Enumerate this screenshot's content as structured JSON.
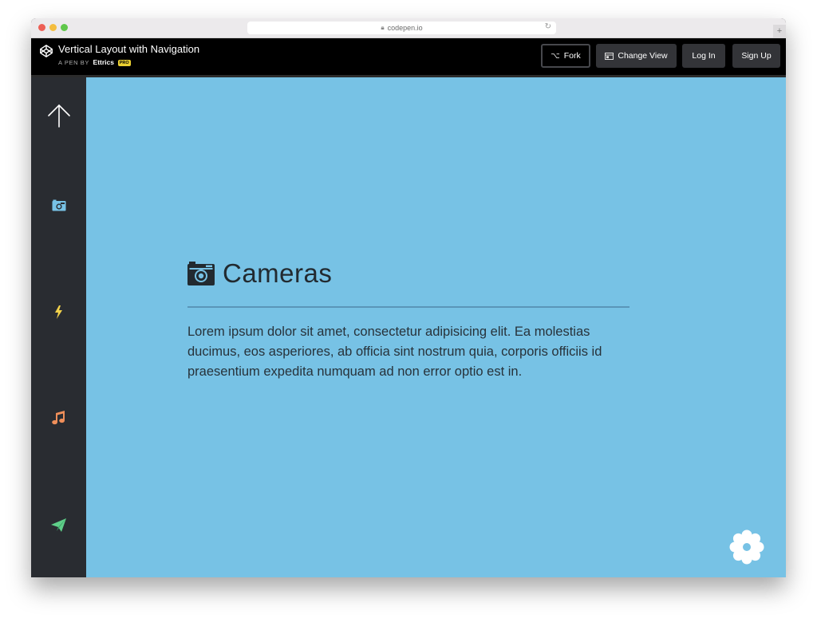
{
  "browser": {
    "url": "codepen.io"
  },
  "header": {
    "title": "Vertical Layout with Navigation",
    "by_prefix": "A PEN BY",
    "author": "Ettrics",
    "badge": "PRO",
    "buttons": {
      "fork": "Fork",
      "change_view": "Change View",
      "login": "Log In",
      "signup": "Sign Up"
    }
  },
  "sidebar": {
    "items": [
      {
        "icon": "up-arrow-icon",
        "color": "#ffffff"
      },
      {
        "icon": "camera-icon",
        "color": "#77c2e5"
      },
      {
        "icon": "lightning-icon",
        "color": "#f2d24b"
      },
      {
        "icon": "music-note-icon",
        "color": "#ef8f5a"
      },
      {
        "icon": "paper-plane-icon",
        "color": "#5fcf89"
      }
    ]
  },
  "main": {
    "title": "Cameras",
    "body": "Lorem ipsum dolor sit amet, consectetur adipisicing elit. Ea molestias ducimus, eos asperiores, ab officia sint nostrum quia, corporis officiis id praesentium expedita numquam ad non error optio est in."
  },
  "colors": {
    "main_bg": "#77c2e5",
    "sidebar_bg": "#292c31",
    "header_bg": "#000000"
  }
}
